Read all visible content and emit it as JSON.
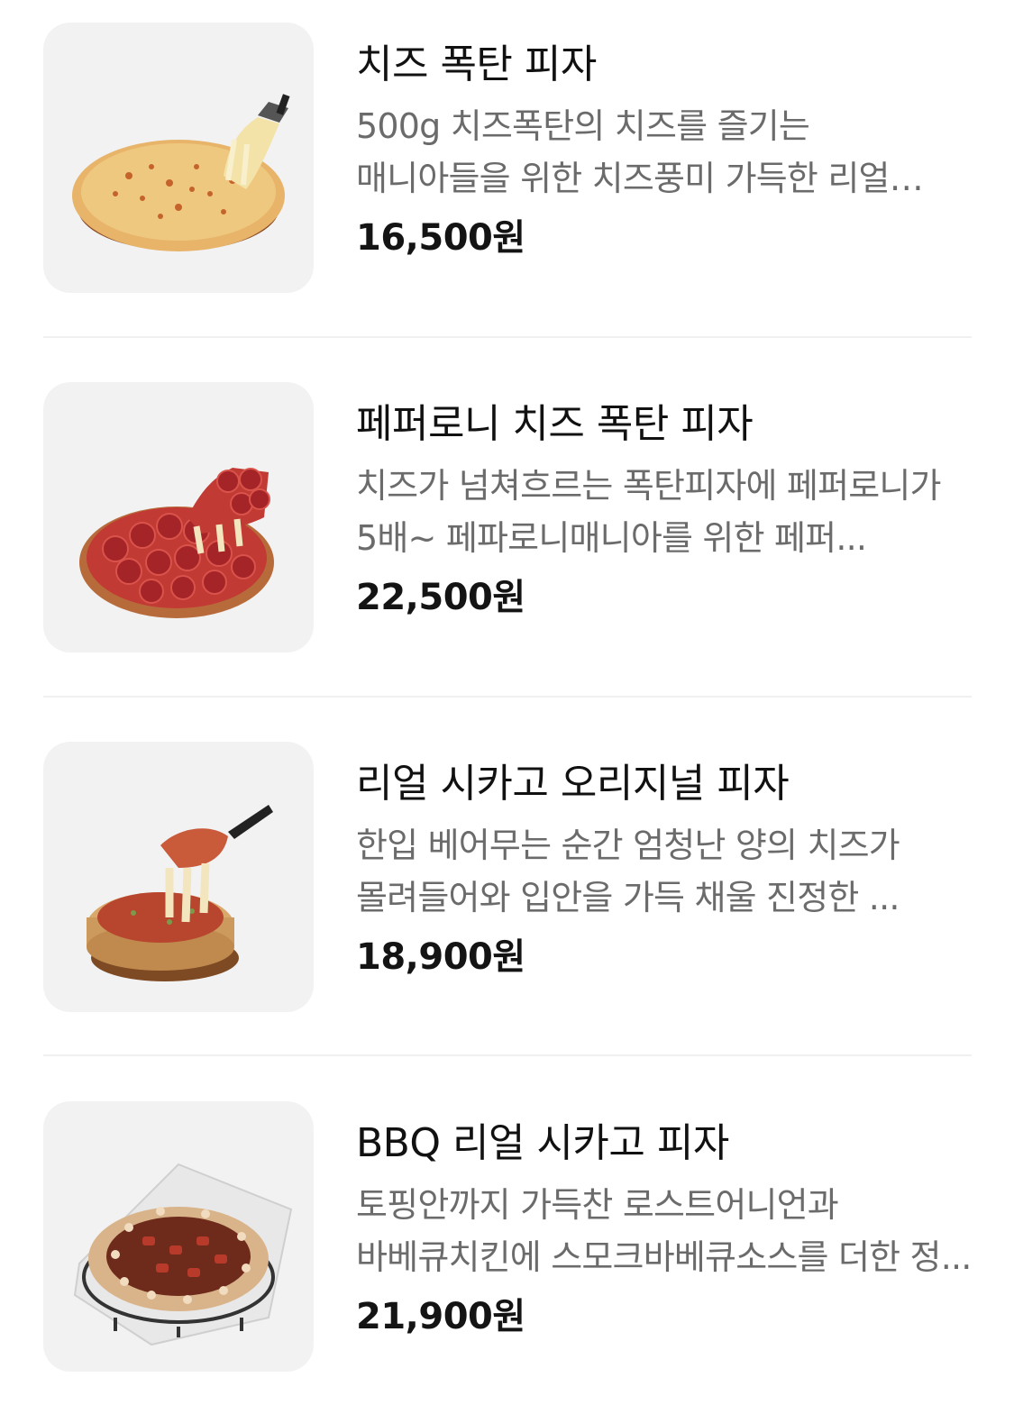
{
  "menu": {
    "items": [
      {
        "name": "치즈 폭탄 피자",
        "description": "500g 치즈폭탄의 치즈를 즐기는 매니아들을 위한 치즈풍미 가득한 리얼 치즈...",
        "price": "16,500원",
        "image_icon": "cheese-pizza-image"
      },
      {
        "name": "페퍼로니 치즈 폭탄 피자",
        "description": "치즈가 넘쳐흐르는 폭탄피자에 페퍼로니가 5배~ 페파로니매니아를 위한 페퍼...",
        "price": "22,500원",
        "image_icon": "pepperoni-pizza-image"
      },
      {
        "name": "리얼 시카고 오리지널 피자",
        "description": "한입 베어무는 순간 엄청난 양의 치즈가 몰려들어와 입안을 가득 채울 진정한 ...",
        "price": "18,900원",
        "image_icon": "chicago-pizza-image"
      },
      {
        "name": "BBQ 리얼 시카고 피자",
        "description": "토핑안까지 가득찬 로스트어니언과 바베큐치킨에 스모크바베큐소스를 더한 정...",
        "price": "21,900원",
        "image_icon": "bbq-pizza-image"
      }
    ]
  },
  "colors": {
    "thumb_bg": "#f2f2f3",
    "description_text": "#6b6b6b",
    "divider": "#f0f0f0"
  }
}
